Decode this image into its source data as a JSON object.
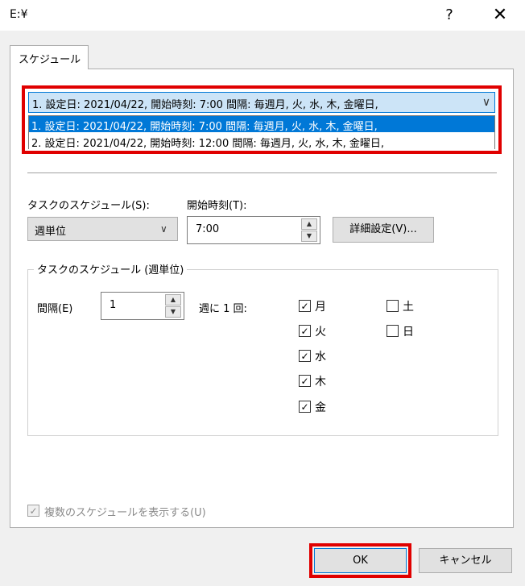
{
  "window": {
    "title": "E:¥",
    "help_label": "?",
    "close_label": "✕"
  },
  "tabs": [
    {
      "label": "スケジュール"
    }
  ],
  "schedule_combo": {
    "selected": "1. 設定日: 2021/04/22, 開始時刻: 7:00  間隔: 毎週月, 火, 水, 木, 金曜日,",
    "options": [
      "1. 設定日: 2021/04/22, 開始時刻: 7:00  間隔: 毎週月, 火, 水, 木, 金曜日,",
      "2. 設定日: 2021/04/22, 開始時刻: 12:00  間隔: 毎週月, 火, 水, 木, 金曜日,"
    ],
    "highlight_color": "#e00000"
  },
  "task_schedule": {
    "label": "タスクのスケジュール(S):",
    "value": "週単位"
  },
  "start_time": {
    "label": "開始時刻(T):",
    "value": "7:00"
  },
  "advanced_button": "詳細設定(V)...",
  "weekly_group": {
    "title": "タスクのスケジュール (週単位)",
    "interval_label": "間隔(E)",
    "interval_value": "1",
    "weekly_label": "週に 1 回:",
    "days": [
      {
        "label": "月",
        "checked": true
      },
      {
        "label": "火",
        "checked": true
      },
      {
        "label": "水",
        "checked": true
      },
      {
        "label": "木",
        "checked": true
      },
      {
        "label": "金",
        "checked": true
      },
      {
        "label": "土",
        "checked": false
      },
      {
        "label": "日",
        "checked": false
      }
    ]
  },
  "show_multiple": {
    "label": "複数のスケジュールを表示する(U)",
    "checked": true
  },
  "buttons": {
    "ok": "OK",
    "cancel": "キャンセル"
  },
  "glyphs": {
    "check": "✓",
    "arrow_down": "∨",
    "spin_up": "▲",
    "spin_down": "▼"
  }
}
